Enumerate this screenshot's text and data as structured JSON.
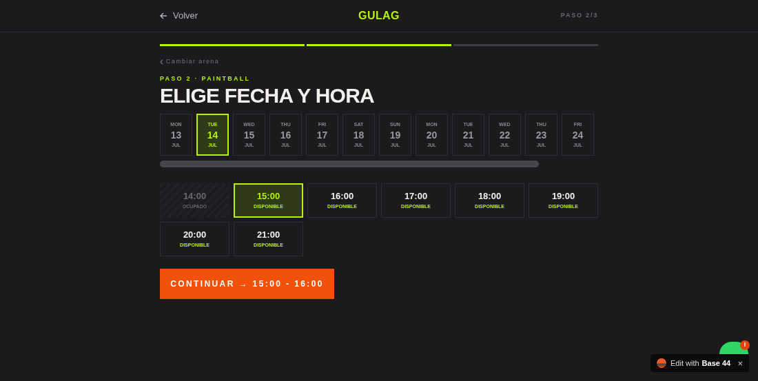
{
  "header": {
    "back": "Volver",
    "logo": "GULAG",
    "step": "PASO 2/3"
  },
  "progress": [
    {
      "done": true
    },
    {
      "done": true
    },
    {
      "done": false
    }
  ],
  "change_link": "Cambiar arena",
  "eyebrow": "PASO 2 · PAINTBALL",
  "title": "ELIGE FECHA Y HORA",
  "dates": [
    {
      "weekday": "MON",
      "day": "13",
      "month": "JUL",
      "selected": false
    },
    {
      "weekday": "TUE",
      "day": "14",
      "month": "JUL",
      "selected": true
    },
    {
      "weekday": "WED",
      "day": "15",
      "month": "JUL",
      "selected": false
    },
    {
      "weekday": "THU",
      "day": "16",
      "month": "JUL",
      "selected": false
    },
    {
      "weekday": "FRI",
      "day": "17",
      "month": "JUL",
      "selected": false
    },
    {
      "weekday": "SAT",
      "day": "18",
      "month": "JUL",
      "selected": false
    },
    {
      "weekday": "SUN",
      "day": "19",
      "month": "JUL",
      "selected": false
    },
    {
      "weekday": "MON",
      "day": "20",
      "month": "JUL",
      "selected": false
    },
    {
      "weekday": "TUE",
      "day": "21",
      "month": "JUL",
      "selected": false
    },
    {
      "weekday": "WED",
      "day": "22",
      "month": "JUL",
      "selected": false
    },
    {
      "weekday": "THU",
      "day": "23",
      "month": "JUL",
      "selected": false
    },
    {
      "weekday": "FRI",
      "day": "24",
      "month": "JUL",
      "selected": false
    }
  ],
  "slots": [
    {
      "time": "14:00",
      "status": "OCUPADO",
      "disabled": true,
      "selected": false
    },
    {
      "time": "15:00",
      "status": "DISPONIBLE",
      "disabled": false,
      "selected": true
    },
    {
      "time": "16:00",
      "status": "DISPONIBLE",
      "disabled": false,
      "selected": false
    },
    {
      "time": "17:00",
      "status": "DISPONIBLE",
      "disabled": false,
      "selected": false
    },
    {
      "time": "18:00",
      "status": "DISPONIBLE",
      "disabled": false,
      "selected": false
    },
    {
      "time": "19:00",
      "status": "DISPONIBLE",
      "disabled": false,
      "selected": false
    },
    {
      "time": "20:00",
      "status": "DISPONIBLE",
      "disabled": false,
      "selected": false
    },
    {
      "time": "21:00",
      "status": "DISPONIBLE",
      "disabled": false,
      "selected": false
    }
  ],
  "continue_button": "CONTINUAR → 15:00 - 16:00",
  "chat_badge": "!",
  "edit_badge": {
    "label": "Edit with",
    "brand": "Base 44",
    "close": "×"
  }
}
